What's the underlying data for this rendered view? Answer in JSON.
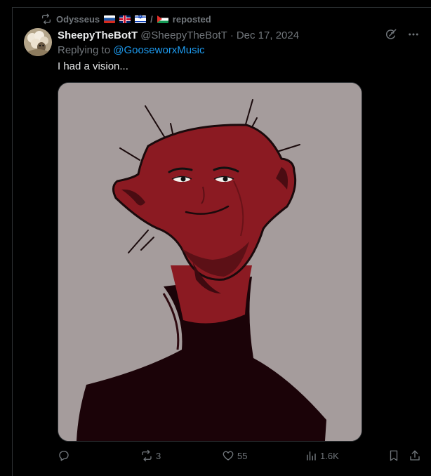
{
  "repost": {
    "icon": "repost-icon",
    "user_name": "Odysseus",
    "flags": [
      "ru",
      "gb",
      "il",
      "ps"
    ],
    "label": "reposted"
  },
  "post": {
    "display_name": "SheepyTheBotT",
    "handle": "@SheepyTheBotT",
    "separator": "·",
    "date": "Dec 17, 2024",
    "reply_prefix": "Replying to",
    "reply_mention": "@GooseworxMusic",
    "text": "I had a vision...",
    "media": "media-image"
  },
  "actions": {
    "reply_count": "",
    "repost_count": "3",
    "like_count": "55",
    "views_count": "1.6K"
  },
  "colors": {
    "background": "#000000",
    "text_primary": "#e7e9ea",
    "text_secondary": "#71767b",
    "link": "#1d9bf0",
    "border": "#2f3336",
    "image_bg": "#a59c9c",
    "figure_red": "#8b1a22",
    "figure_body": "#1b0308"
  }
}
